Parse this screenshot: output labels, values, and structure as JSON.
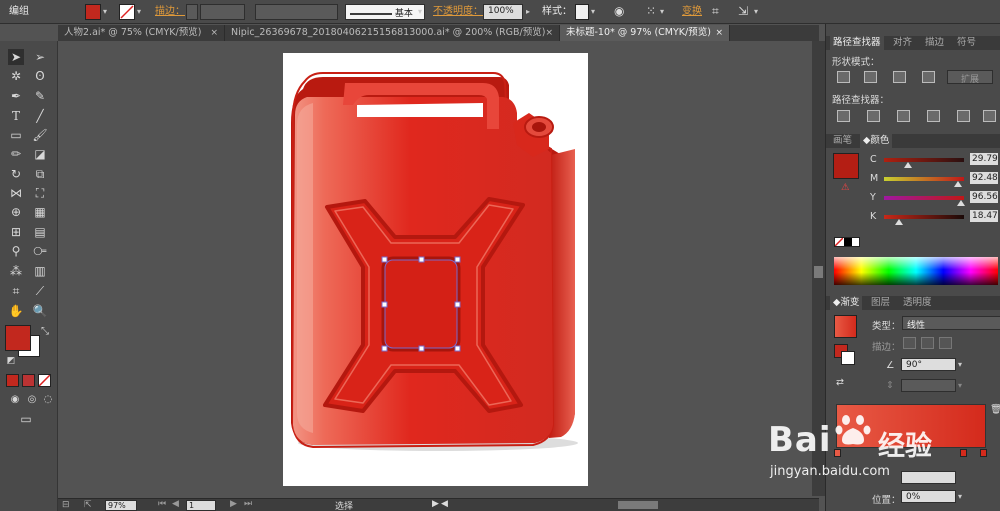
{
  "control_bar": {
    "mode_label": "编组",
    "stroke_label": "描边：",
    "brush_label": "基本",
    "opacity_label": "不透明度：",
    "opacity_value": "100%",
    "style_label": "样式：",
    "transform_label": "变换",
    "fill_color": "#c2281e"
  },
  "tabs": [
    {
      "label": "人物2.ai* @ 75% (CMYK/预览)",
      "close": "×"
    },
    {
      "label": "Nipic_26369678_20180406215156813000.ai* @ 200% (RGB/预览)",
      "close": "×"
    },
    {
      "label": "未标题-10* @ 97% (CMYK/预览)",
      "close": "×"
    }
  ],
  "status_bar": {
    "zoom": "97%",
    "page": "1",
    "mode": "选择"
  },
  "pathfinder": {
    "tabs": [
      "路径查找器",
      "对齐",
      "描边",
      "符号"
    ],
    "shape_modes_label": "形状模式：",
    "expand_label": "扩展",
    "pathfinders_label": "路径查找器："
  },
  "color_panel": {
    "tabs": [
      "画笔",
      "颜色"
    ],
    "fill_color": "#b41e14",
    "channels": [
      {
        "name": "C",
        "value": "29.79",
        "pct": 29.79
      },
      {
        "name": "M",
        "value": "92.48",
        "pct": 92.48
      },
      {
        "name": "Y",
        "value": "96.56",
        "pct": 96.56
      },
      {
        "name": "K",
        "value": "18.47",
        "pct": 18.47
      }
    ]
  },
  "gradient_panel": {
    "tabs": [
      "渐变",
      "图层",
      "透明度"
    ],
    "type_label": "类型：",
    "type_value": "线性",
    "stroke_label": "描边：",
    "angle_value": "90°",
    "position_label": "位置：",
    "position_value": "0%",
    "start_color": "#e85a45",
    "end_color": "#d42a1c"
  },
  "watermark": {
    "brand": "Bai",
    "brand_suffix": "经验",
    "url": "jingyan.baidu.com"
  },
  "artwork": {
    "body_color": "#e0281e",
    "highlight_color": "#f07868",
    "selection_color": "#7a68c8"
  }
}
